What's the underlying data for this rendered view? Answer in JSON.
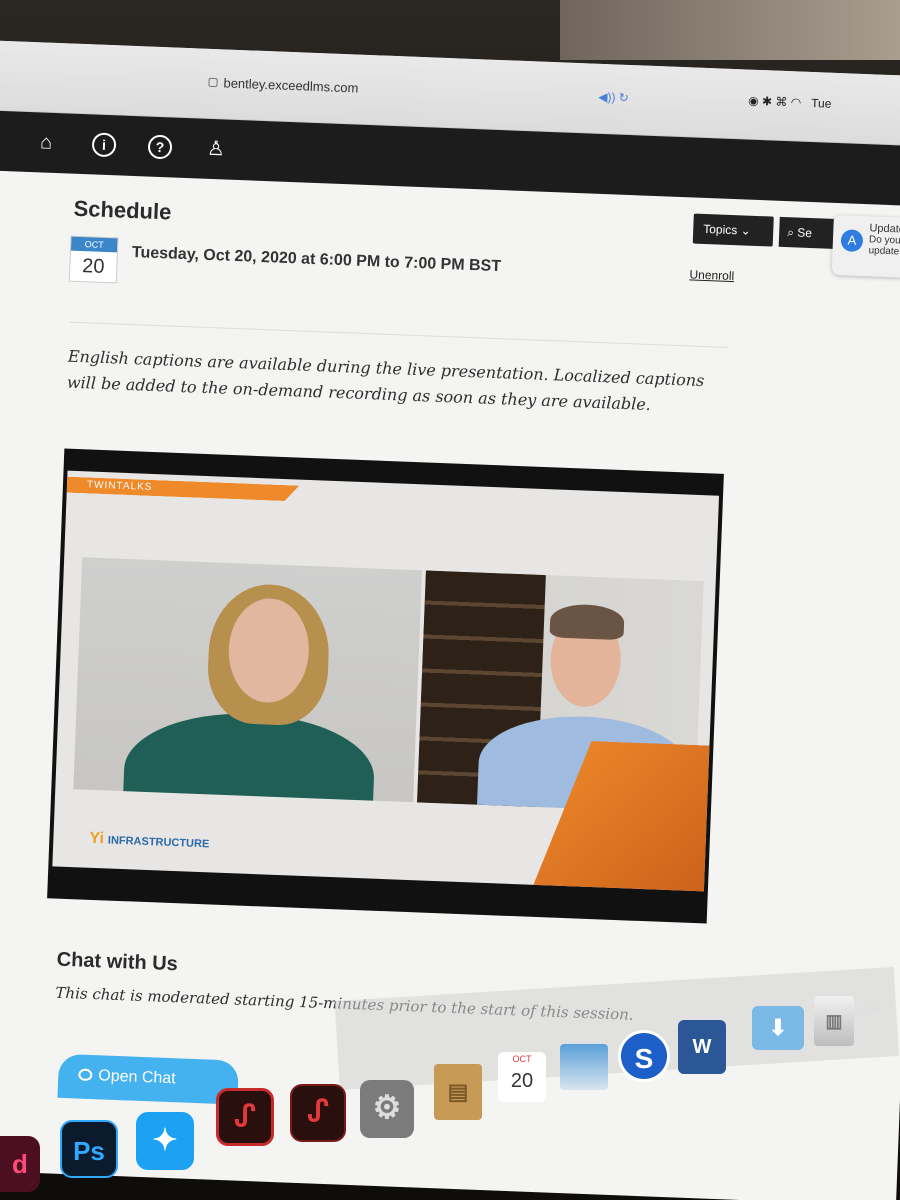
{
  "browser": {
    "url": "bentley.exceedlms.com",
    "sound_icon": "speaker-icon",
    "notification": {
      "title": "Update",
      "line1": "Do you",
      "line2": "update"
    },
    "menubar_time_fragment": "Tue"
  },
  "appbar": {
    "icons": [
      "list-icon",
      "bank-icon",
      "info-icon",
      "help-icon",
      "user-switch-icon"
    ]
  },
  "schedule": {
    "title": "Schedule",
    "topics_label": "Topics",
    "search_label": "Se",
    "calendar_month": "OCT",
    "calendar_day": "20",
    "datetime": "Tuesday, Oct 20, 2020 at 6:00 PM to 7:00 PM BST",
    "unenroll": "Unenroll"
  },
  "captions_text": "English captions are available during the live presentation. Localized captions will be added to the on-demand recording as soon as they are available.",
  "video": {
    "banner": "TWINTALKS",
    "logo_text": "INFRASTRUCTURE"
  },
  "chat": {
    "title": "Chat with Us",
    "description": "This chat is moderated starting 15-minutes prior to the start of this session.",
    "open_chat_label": "Open Chat",
    "side_fragment": "e to"
  },
  "dock": {
    "apps": [
      "indesign",
      "photoshop",
      "twitter",
      "acrobat",
      "acrobat-reader",
      "system-preferences",
      "notebook",
      "calendar",
      "preview",
      "skype",
      "word",
      "downloads",
      "trash"
    ],
    "ps_label": "Ps",
    "id_label": "d",
    "word_label": "W",
    "skype_label": "S",
    "calendar_month": "OCT",
    "calendar_day": "20"
  }
}
